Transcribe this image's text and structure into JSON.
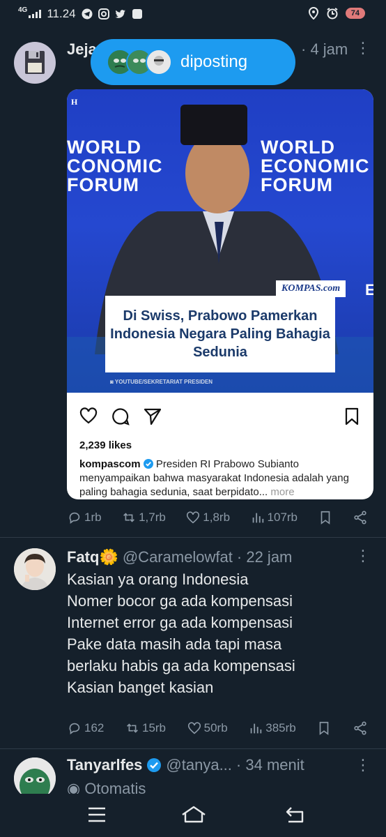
{
  "status_bar": {
    "network": "4G",
    "time": "11.24",
    "battery": "74",
    "icons": [
      "telegram-icon",
      "instagram-icon",
      "twitter-icon",
      "app-icon",
      "location-icon",
      "alarm-icon"
    ]
  },
  "posted_pill": {
    "arrow": "↑",
    "label": "diposting"
  },
  "tweets": [
    {
      "name": "Jeja",
      "time": "· 4 jam",
      "media": {
        "wef_text": "WORLD\nECONOMIC\nFORUM",
        "wef_left_text": "WORLD\nCONOMIC\nFORUM",
        "kompas_logo": "KOMPAS.com",
        "headline": "Di Swiss, Prabowo Pamerkan Indonesia Negara Paling Bahagia Sedunia",
        "credit": "YOUTUBE/SEKRETARIAT PRESIDEN",
        "likes": "2,239 likes",
        "caption_user": "kompascom",
        "caption_text": " Presiden RI Prabowo Subianto menyampaikan bahwa masyarakat Indonesia adalah yang paling bahagia sedunia, saat berpidato...",
        "caption_more": " more"
      },
      "replies": "1rb",
      "retweets": "1,7rb",
      "likes": "1,8rb",
      "views": "107rb"
    },
    {
      "name": "Fatq🌼",
      "handle": "@Caramelowfat",
      "time": "· 22 jam",
      "text": "Kasian ya orang Indonesia\nNomer bocor ga ada kompensasi\nInternet error ga ada kompensasi\nPake data masih ada tapi masa\nberlaku habis ga ada kompensasi\nKasian banget kasian",
      "replies": "162",
      "retweets": "15rb",
      "likes": "50rb",
      "views": "385rb"
    },
    {
      "name": "Tanyarlfes",
      "handle": "@tanya...",
      "time": "· 34 menit",
      "label": "Otomatis"
    }
  ],
  "colors": {
    "background": "#15202b",
    "accent": "#1d9bf0",
    "muted": "#8b98a5"
  }
}
